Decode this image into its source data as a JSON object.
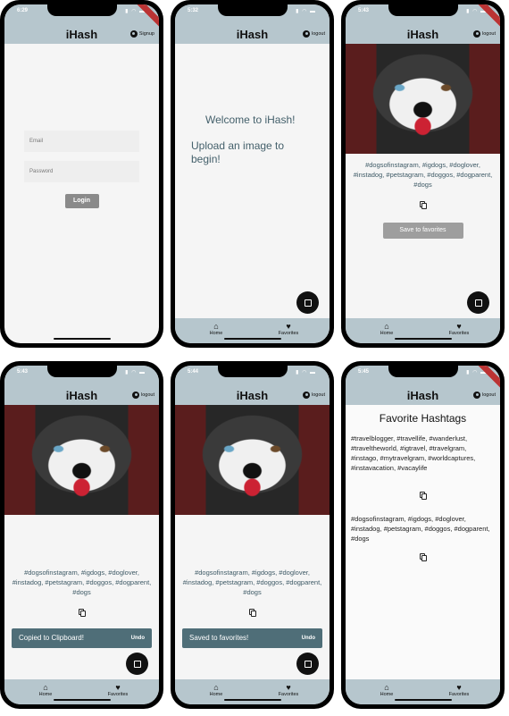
{
  "app": {
    "title": "iHash"
  },
  "screens": [
    {
      "time": "6:29",
      "action": "Signup",
      "email_placeholder": "Email",
      "password_placeholder": "Password",
      "login_label": "Login"
    },
    {
      "time": "5:32",
      "action": "logout",
      "welcome": "Welcome to iHash!",
      "upload": "Upload an image to begin!",
      "nav_home": "Home",
      "nav_fav": "Favorites"
    },
    {
      "time": "5:43",
      "action": "logout",
      "tags": "#dogsofinstagram, #igdogs, #doglover, #instadog, #petstagram, #doggos, #dogparent, #dogs",
      "save_label": "Save to favorites",
      "nav_home": "Home",
      "nav_fav": "Favorites"
    },
    {
      "time": "5:43",
      "action": "logout",
      "tags": "#dogsofinstagram, #igdogs, #doglover, #instadog, #petstagram, #doggos, #dogparent, #dogs",
      "snack": "Copied to Clipboard!",
      "undo": "Undo",
      "nav_home": "Home",
      "nav_fav": "Favorites"
    },
    {
      "time": "5:44",
      "action": "logout",
      "tags": "#dogsofinstagram, #igdogs, #doglover, #instadog, #petstagram, #doggos, #dogparent, #dogs",
      "snack": "Saved to favorites!",
      "undo": "Undo",
      "nav_home": "Home",
      "nav_fav": "Favorites"
    },
    {
      "time": "5:45",
      "action": "logout",
      "fav_title": "Favorite Hashtags",
      "fav1": "#travelblogger, #travellife, #wanderlust, #traveltheworld, #igtravel, #travelgram, #instago, #mytravelgram, #worldcaptures, #instavacation, #vacaylife",
      "fav2": "#dogsofinstagram, #igdogs, #doglover, #instadog, #petstagram, #doggos, #dogparent, #dogs",
      "nav_home": "Home",
      "nav_fav": "Favorites"
    }
  ]
}
